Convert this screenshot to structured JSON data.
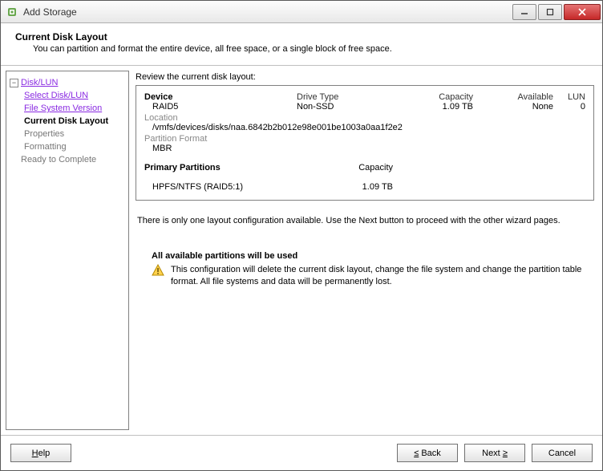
{
  "titlebar": {
    "title": "Add Storage"
  },
  "header": {
    "title": "Current Disk Layout",
    "description": "You can partition and format the entire device, all free space, or a single block of free space."
  },
  "nav": {
    "root": "Disk/LUN",
    "items": [
      "Select Disk/LUN",
      "File System Version",
      "Current Disk Layout",
      "Properties",
      "Formatting"
    ],
    "ready": "Ready to Complete"
  },
  "content": {
    "review_label": "Review the current disk layout:",
    "device_header": "Device",
    "drive_type_header": "Drive Type",
    "capacity_header": "Capacity",
    "available_header": "Available",
    "lun_header": "LUN",
    "device_name": "RAID5",
    "drive_type": "Non-SSD",
    "capacity": "1.09 TB",
    "available": "None",
    "lun": "0",
    "location_label": "Location",
    "location_path": "/vmfs/devices/disks/naa.6842b2b012e98e001be1003a0aa1f2e2",
    "partfmt_label": "Partition Format",
    "partfmt_value": "MBR",
    "primary_header": "Primary Partitions",
    "primary_capacity_header": "Capacity",
    "primary_name": "HPFS/NTFS (RAID5:1)",
    "primary_capacity": "1.09 TB",
    "info_text": "There is only one layout configuration available. Use the Next button to proceed with the other wizard pages.",
    "warn_title": "All available partitions will be used",
    "warn_text": "This configuration will delete the current disk layout, change the file system and change the partition table format. All file systems and data will be permanently lost."
  },
  "footer": {
    "help": "Help",
    "back": "Back",
    "next": "Next",
    "cancel": "Cancel"
  }
}
